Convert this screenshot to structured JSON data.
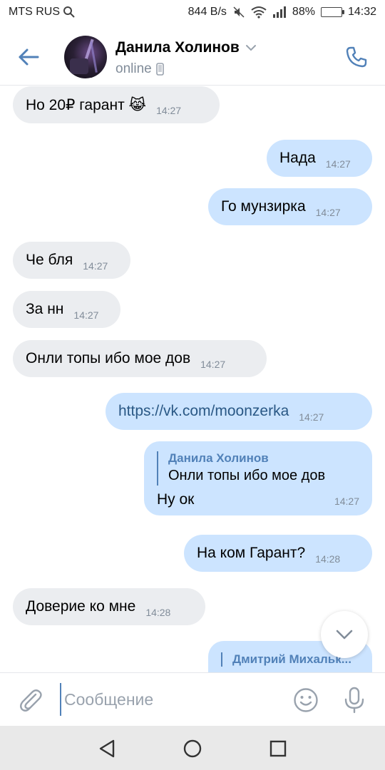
{
  "status_bar": {
    "carrier": "MTS RUS",
    "net_speed": "844 B/s",
    "battery": "88%",
    "battery_level": 0.88,
    "time": "14:32"
  },
  "header": {
    "name": "Данила Холинов",
    "status": "online"
  },
  "messages": [
    {
      "dir": "in",
      "text": "Но 20₽ гарант 😹",
      "time": "14:27"
    },
    {
      "dir": "out",
      "text": "Нада",
      "time": "14:27"
    },
    {
      "dir": "out",
      "text": "Го мунзирка",
      "time": "14:27"
    },
    {
      "dir": "in",
      "text": "Че бля",
      "time": "14:27"
    },
    {
      "dir": "in",
      "text": "За нн",
      "time": "14:27"
    },
    {
      "dir": "in",
      "text": "Онли топы ибо мое дов",
      "time": "14:27"
    },
    {
      "dir": "out",
      "text": "https://vk.com/moonzerka",
      "time": "14:27"
    },
    {
      "dir": "out",
      "reply_author": "Данила Холинов",
      "reply_text": "Онли топы ибо мое дов",
      "text": "Ну ок",
      "time": "14:27"
    },
    {
      "dir": "out",
      "text": "На ком Гарант?",
      "time": "14:28"
    },
    {
      "dir": "in",
      "text": "Доверие ко мне",
      "time": "14:28"
    },
    {
      "dir": "out",
      "reply_author": "Дмитрий Михальк..."
    }
  ],
  "composer": {
    "placeholder": "Сообщение"
  },
  "colors": {
    "accent": "#5181b8",
    "incoming_bubble": "#ebedf0",
    "outgoing_bubble": "#cce4ff",
    "secondary_text": "#818c99"
  },
  "icons": {
    "back": "arrow-left-icon",
    "phone": "phone-icon",
    "attach": "paperclip-icon",
    "emoji": "smile-icon",
    "mic": "microphone-icon",
    "scroll": "chevron-down-icon",
    "nav_back": "triangle-back-icon",
    "nav_home": "circle-home-icon",
    "nav_recents": "square-recents-icon"
  }
}
